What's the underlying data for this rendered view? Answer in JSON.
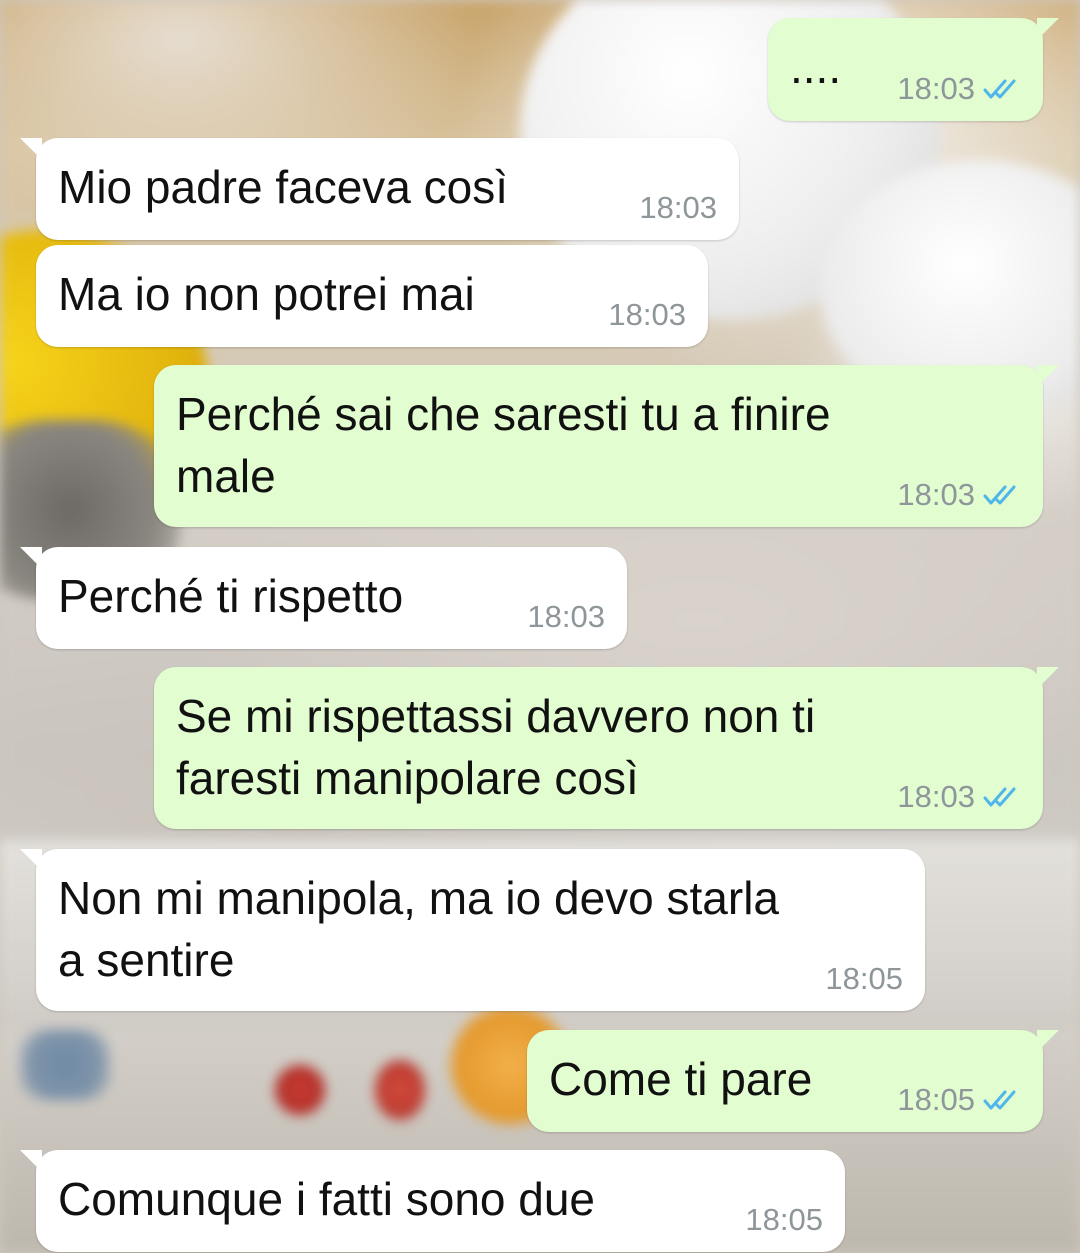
{
  "colors": {
    "incoming_bubble": "#ffffff",
    "outgoing_bubble": "#e2fdd0",
    "text": "#111111",
    "timestamp": "#8e9699",
    "read_ticks": "#4fb6ec"
  },
  "messages": [
    {
      "direction": "out",
      "text": "....",
      "time": "18:03",
      "status_icon": "double-check-read-icon"
    },
    {
      "direction": "in",
      "text": "Mio padre faceva così",
      "time": "18:03"
    },
    {
      "direction": "in",
      "text": "Ma io non potrei mai",
      "time": "18:03"
    },
    {
      "direction": "out",
      "text": "Perché sai che saresti tu a finire\nmale",
      "time": "18:03",
      "status_icon": "double-check-read-icon"
    },
    {
      "direction": "in",
      "text": "Perché ti rispetto",
      "time": "18:03"
    },
    {
      "direction": "out",
      "text": "Se mi rispettassi davvero non ti\nfaresti manipolare così",
      "time": "18:03",
      "status_icon": "double-check-read-icon"
    },
    {
      "direction": "in",
      "text": "Non mi manipola, ma io devo starla\na sentire",
      "time": "18:05"
    },
    {
      "direction": "out",
      "text": "Come ti pare",
      "time": "18:05",
      "status_icon": "double-check-read-icon"
    },
    {
      "direction": "in",
      "text": "Comunque i fatti sono due",
      "time": "18:05"
    }
  ]
}
